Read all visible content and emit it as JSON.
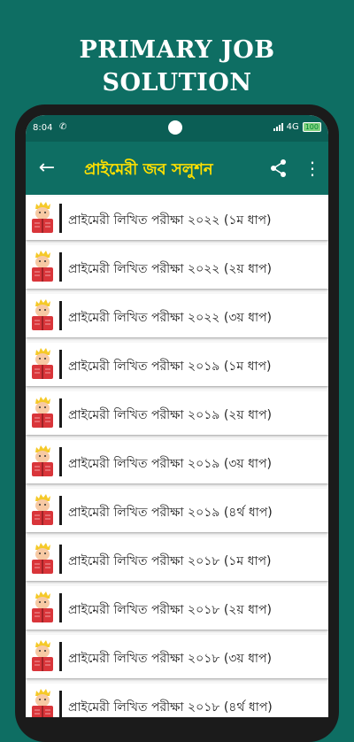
{
  "promo": {
    "title_line1": "PRIMARY JOB",
    "title_line2": "SOLUTION"
  },
  "statusbar": {
    "time": "8:04",
    "network": "4G",
    "battery": "100"
  },
  "appbar": {
    "title": "প্রাইমেরী জব সলুশন",
    "back_icon": "arrow-left-icon",
    "share_icon": "share-icon",
    "more_icon": "more-vert-icon"
  },
  "colors": {
    "primary": "#0e6e63",
    "status": "#0b5e55",
    "title_yellow": "#ffe000"
  },
  "items": [
    {
      "label": "প্রাইমেরী লিখিত পরীক্ষা  ২০২২ (১ম ধাপ)"
    },
    {
      "label": "প্রাইমেরী লিখিত পরীক্ষা ২০২২ (২য় ধাপ)"
    },
    {
      "label": "প্রাইমেরী লিখিত পরীক্ষা ২০২২ (৩য় ধাপ)"
    },
    {
      "label": "প্রাইমেরী লিখিত পরীক্ষা ২০১৯ (১ম ধাপ)"
    },
    {
      "label": "প্রাইমেরী লিখিত পরীক্ষা ২০১৯ (২য় ধাপ)"
    },
    {
      "label": "প্রাইমেরী লিখিত পরীক্ষা ২০১৯ (৩য় ধাপ)"
    },
    {
      "label": "প্রাইমেরী লিখিত পরীক্ষা ২০১৯ (৪র্থ ধাপ)"
    },
    {
      "label": "প্রাইমেরী লিখিত পরীক্ষা ২০১৮ (১ম ধাপ)"
    },
    {
      "label": "প্রাইমেরী লিখিত পরীক্ষা ২০১৮ (২য় ধাপ)"
    },
    {
      "label": "প্রাইমেরী লিখিত পরীক্ষা ২০১৮ (৩য় ধাপ)"
    },
    {
      "label": "প্রাইমেরী লিখিত পরীক্ষা ২০১৮ (৪র্থ ধাপ)"
    }
  ]
}
